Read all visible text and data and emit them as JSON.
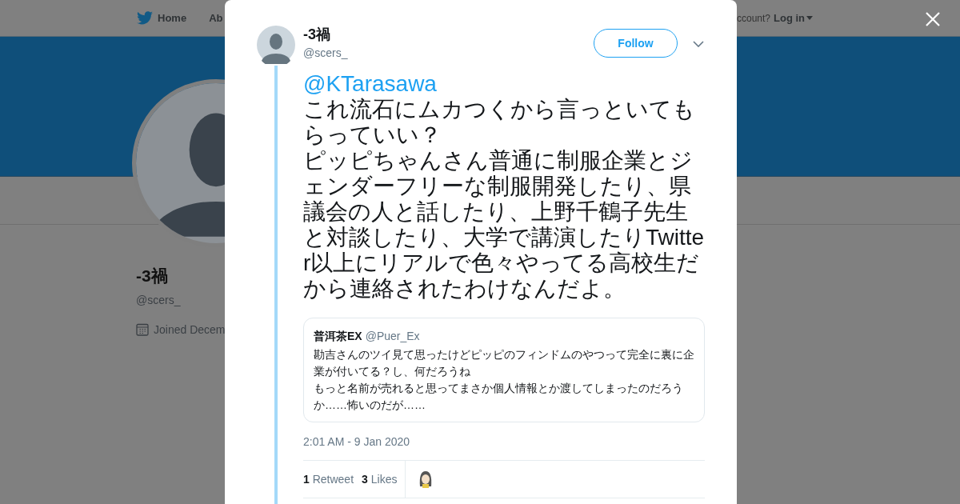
{
  "nav": {
    "items": [
      {
        "label": "Home"
      },
      {
        "label": "Ab"
      }
    ],
    "account_prompt": "ccount?",
    "login": "Log in"
  },
  "profile": {
    "name": "-3禍",
    "handle": "@scers_",
    "joined": "Joined Decem"
  },
  "tweet": {
    "author": "-3禍",
    "handle": "@scers_",
    "follow_button": "Follow",
    "mention": "@KTarasawa",
    "body": [
      "これ流石にムカつくから言っといてもらっていい？",
      "ピッピちゃんさん普通に制服企業とジェンダーフリーな制服開発したり、県議会の人と話したり、上野千鶴子先生と対談したり、大学で講演したりTwitter以上にリアルで色々やってる高校生だから連絡されたわけなんだよ。"
    ],
    "quote": {
      "name": "普洱茶EX",
      "handle": "@Puer_Ex",
      "text": [
        "勘吉さんのツイ見て思ったけどピッピのフィンドムのやつって完全に裏に企業が付いてる？し、何だろうね",
        "もっと名前が売れると思ってまさか個人情報とか渡してしまったのだろうか……怖いのだが……"
      ]
    },
    "timestamp": "2:01 AM - 9 Jan 2020",
    "stats": [
      {
        "count": "1",
        "label": "Retweet"
      },
      {
        "count": "3",
        "label": "Likes"
      }
    ]
  }
}
